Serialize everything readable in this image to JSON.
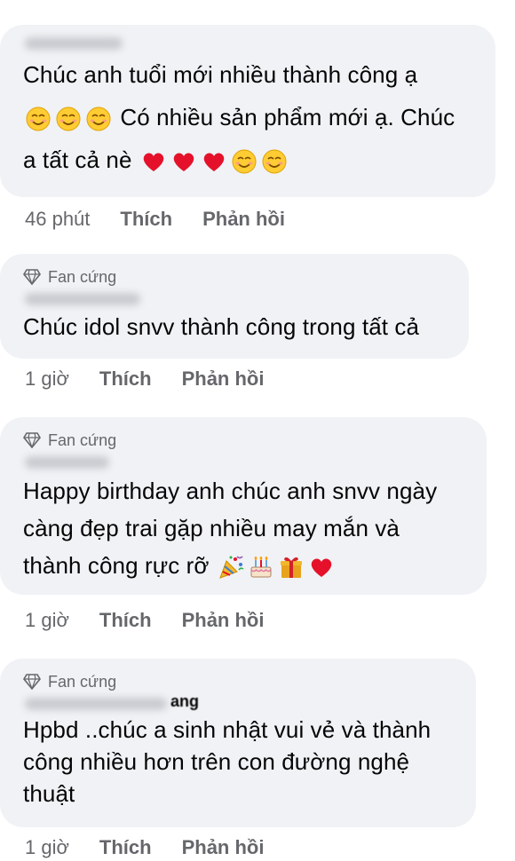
{
  "comments": [
    {
      "has_badge": false,
      "text_line1": "Chúc anh tuổi mới nhiều thành công ạ",
      "text_line2": "Có nhiều sản phẩm mới ạ. Chúc",
      "text_line3": "a tất cả nè",
      "time": "46 phút",
      "like": "Thích",
      "reply": "Phản hồi",
      "emojis_line2": [
        "smiling-blush-emoji",
        "smiling-blush-emoji",
        "smiling-blush-emoji"
      ],
      "emojis_line3": [
        "red-heart-emoji",
        "red-heart-emoji",
        "red-heart-emoji",
        "smiling-blush-emoji",
        "smiling-blush-emoji"
      ]
    },
    {
      "badge": "Fan cứng",
      "text_line1": "Chúc idol snvv thành công trong tất cả",
      "time": "1 giờ",
      "like": "Thích",
      "reply": "Phản hồi"
    },
    {
      "badge": "Fan cứng",
      "text_line1": "Happy birthday anh chúc anh snvv ngày",
      "text_line2": "càng đẹp trai gặp nhiều may mắn và",
      "text_line3": "thành công rực rỡ",
      "time": "1 giờ",
      "like": "Thích",
      "reply": "Phản hồi",
      "emojis_line3": [
        "party-popper-emoji",
        "birthday-cake-emoji",
        "gift-emoji",
        "red-heart-emoji"
      ]
    },
    {
      "badge": "Fan cứng",
      "name_tail": "ang",
      "text_line1": "Hpbd ..chúc a sinh nhật vui vẻ và thành",
      "text_line2": "công nhiều hơn trên con đường nghệ",
      "text_line3": "thuật",
      "time": "1 giờ",
      "like": "Thích",
      "reply": "Phản hồi"
    }
  ],
  "colors": {
    "bubble": "#f0f2f5",
    "meta_text": "#65676b",
    "body_text": "#050505"
  }
}
